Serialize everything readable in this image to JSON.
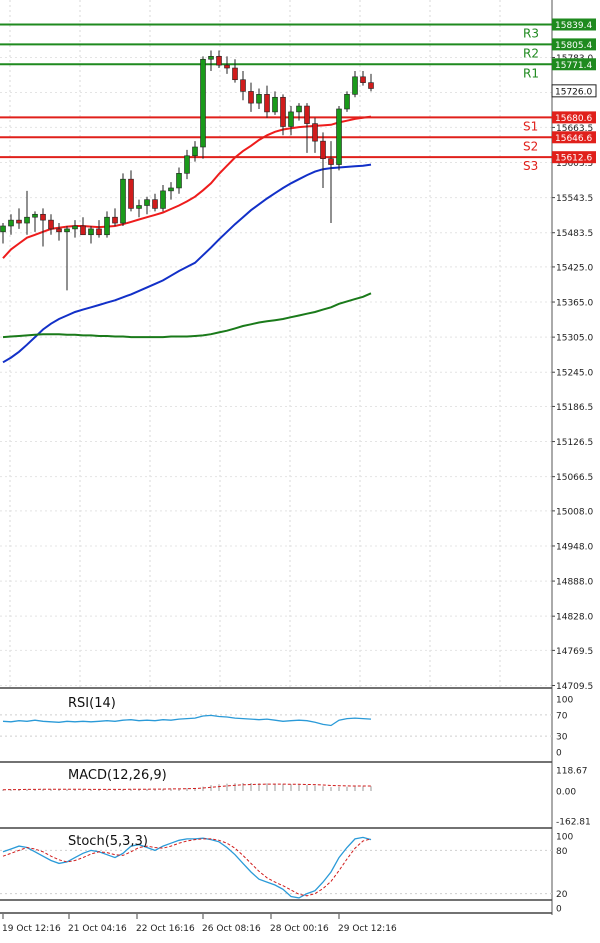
{
  "chart_data": {
    "type": "candlestick",
    "timeframe_labels": [
      "19 Oct 12:16",
      "21 Oct 04:16",
      "22 Oct 16:16",
      "26 Oct 08:16",
      "28 Oct 00:16",
      "29 Oct 12:16"
    ],
    "price_axis": {
      "ticks": [
        "15839.4",
        "15783.0",
        "15723.1",
        "15663.5",
        "15603.5",
        "15543.5",
        "15483.5",
        "15425.0",
        "15365.0",
        "15305.0",
        "15245.0",
        "15186.5",
        "15126.5",
        "15066.5",
        "15008.0",
        "14948.0",
        "14888.0",
        "14828.0",
        "14769.5",
        "14709.5"
      ],
      "current_price": "15726.0"
    },
    "levels": [
      {
        "name": "R3",
        "value": 15839.4,
        "label": "15839.4",
        "kind": "resistance",
        "color": "#1f8a1f"
      },
      {
        "name": "R2",
        "value": 15805.4,
        "label": "15805.4",
        "kind": "resistance",
        "color": "#1f8a1f"
      },
      {
        "name": "R1",
        "value": 15771.4,
        "label": "15771.4",
        "kind": "resistance",
        "color": "#1f8a1f"
      },
      {
        "name": "S1",
        "value": 15680.6,
        "label": "15680.6",
        "kind": "support",
        "color": "#e0201b"
      },
      {
        "name": "S2",
        "value": 15646.6,
        "label": "15646.6",
        "kind": "support",
        "color": "#e0201b"
      },
      {
        "name": "S3",
        "value": 15612.6,
        "label": "15612.6",
        "kind": "support",
        "color": "#e0201b"
      }
    ],
    "candles": [
      {
        "o": 15485,
        "h": 15500,
        "l": 15465,
        "c": 15495
      },
      {
        "o": 15495,
        "h": 15515,
        "l": 15480,
        "c": 15505
      },
      {
        "o": 15505,
        "h": 15525,
        "l": 15490,
        "c": 15500
      },
      {
        "o": 15500,
        "h": 15555,
        "l": 15480,
        "c": 15510
      },
      {
        "o": 15510,
        "h": 15520,
        "l": 15485,
        "c": 15515
      },
      {
        "o": 15515,
        "h": 15525,
        "l": 15460,
        "c": 15505
      },
      {
        "o": 15505,
        "h": 15515,
        "l": 15480,
        "c": 15490
      },
      {
        "o": 15490,
        "h": 15500,
        "l": 15470,
        "c": 15485
      },
      {
        "o": 15485,
        "h": 15495,
        "l": 15385,
        "c": 15490
      },
      {
        "o": 15490,
        "h": 15505,
        "l": 15475,
        "c": 15495
      },
      {
        "o": 15495,
        "h": 15510,
        "l": 15480,
        "c": 15480
      },
      {
        "o": 15480,
        "h": 15495,
        "l": 15465,
        "c": 15490
      },
      {
        "o": 15490,
        "h": 15505,
        "l": 15475,
        "c": 15480
      },
      {
        "o": 15480,
        "h": 15520,
        "l": 15475,
        "c": 15510
      },
      {
        "o": 15510,
        "h": 15525,
        "l": 15495,
        "c": 15500
      },
      {
        "o": 15500,
        "h": 15585,
        "l": 15495,
        "c": 15575
      },
      {
        "o": 15575,
        "h": 15590,
        "l": 15520,
        "c": 15525
      },
      {
        "o": 15525,
        "h": 15540,
        "l": 15510,
        "c": 15530
      },
      {
        "o": 15530,
        "h": 15545,
        "l": 15515,
        "c": 15540
      },
      {
        "o": 15540,
        "h": 15550,
        "l": 15520,
        "c": 15525
      },
      {
        "o": 15525,
        "h": 15565,
        "l": 15520,
        "c": 15555
      },
      {
        "o": 15555,
        "h": 15570,
        "l": 15540,
        "c": 15560
      },
      {
        "o": 15560,
        "h": 15595,
        "l": 15550,
        "c": 15585
      },
      {
        "o": 15585,
        "h": 15625,
        "l": 15575,
        "c": 15615
      },
      {
        "o": 15615,
        "h": 15640,
        "l": 15605,
        "c": 15630
      },
      {
        "o": 15630,
        "h": 15785,
        "l": 15610,
        "c": 15780
      },
      {
        "o": 15780,
        "h": 15795,
        "l": 15760,
        "c": 15785
      },
      {
        "o": 15785,
        "h": 15795,
        "l": 15765,
        "c": 15770
      },
      {
        "o": 15770,
        "h": 15785,
        "l": 15755,
        "c": 15765
      },
      {
        "o": 15765,
        "h": 15780,
        "l": 15740,
        "c": 15745
      },
      {
        "o": 15745,
        "h": 15760,
        "l": 15710,
        "c": 15725
      },
      {
        "o": 15725,
        "h": 15740,
        "l": 15690,
        "c": 15705
      },
      {
        "o": 15705,
        "h": 15730,
        "l": 15695,
        "c": 15720
      },
      {
        "o": 15720,
        "h": 15735,
        "l": 15680,
        "c": 15690
      },
      {
        "o": 15690,
        "h": 15725,
        "l": 15685,
        "c": 15715
      },
      {
        "o": 15715,
        "h": 15720,
        "l": 15650,
        "c": 15665
      },
      {
        "o": 15665,
        "h": 15700,
        "l": 15650,
        "c": 15690
      },
      {
        "o": 15690,
        "h": 15705,
        "l": 15675,
        "c": 15700
      },
      {
        "o": 15700,
        "h": 15705,
        "l": 15620,
        "c": 15670
      },
      {
        "o": 15670,
        "h": 15680,
        "l": 15620,
        "c": 15640
      },
      {
        "o": 15640,
        "h": 15655,
        "l": 15560,
        "c": 15610
      },
      {
        "o": 15610,
        "h": 15640,
        "l": 15500,
        "c": 15600
      },
      {
        "o": 15600,
        "h": 15700,
        "l": 15590,
        "c": 15695
      },
      {
        "o": 15695,
        "h": 15725,
        "l": 15690,
        "c": 15720
      },
      {
        "o": 15720,
        "h": 15760,
        "l": 15715,
        "c": 15750
      },
      {
        "o": 15750,
        "h": 15760,
        "l": 15735,
        "c": 15740
      },
      {
        "o": 15740,
        "h": 15755,
        "l": 15725,
        "c": 15730
      }
    ],
    "moving_averages": [
      {
        "name": "MA fast",
        "color": "#ee1c1c",
        "values": [
          15440,
          15455,
          15465,
          15475,
          15480,
          15485,
          15490,
          15492,
          15494,
          15495,
          15495,
          15494,
          15493,
          15494,
          15495,
          15498,
          15502,
          15506,
          15510,
          15514,
          15518,
          15524,
          15530,
          15537,
          15545,
          15556,
          15568,
          15584,
          15598,
          15612,
          15623,
          15632,
          15642,
          15650,
          15656,
          15660,
          15662,
          15664,
          15665,
          15666,
          15667,
          15668,
          15672,
          15675,
          15678,
          15680,
          15682
        ]
      },
      {
        "name": "MA mid",
        "color": "#1230c8",
        "values": [
          15262,
          15270,
          15280,
          15292,
          15305,
          15318,
          15328,
          15336,
          15342,
          15348,
          15352,
          15356,
          15360,
          15364,
          15368,
          15373,
          15378,
          15384,
          15390,
          15396,
          15402,
          15410,
          15418,
          15425,
          15432,
          15445,
          15458,
          15472,
          15485,
          15498,
          15510,
          15522,
          15532,
          15542,
          15551,
          15560,
          15568,
          15575,
          15582,
          15588,
          15592,
          15594,
          15595,
          15596,
          15597,
          15598,
          15600
        ]
      },
      {
        "name": "MA slow",
        "color": "#1a7a1a",
        "values": [
          15305,
          15306,
          15307,
          15308,
          15309,
          15310,
          15310,
          15310,
          15309,
          15309,
          15308,
          15308,
          15307,
          15307,
          15306,
          15306,
          15305,
          15305,
          15305,
          15305,
          15305,
          15306,
          15306,
          15306,
          15307,
          15308,
          15310,
          15313,
          15316,
          15320,
          15324,
          15327,
          15330,
          15332,
          15334,
          15336,
          15339,
          15342,
          15345,
          15348,
          15352,
          15356,
          15362,
          15366,
          15370,
          15374,
          15380
        ]
      }
    ],
    "rsi": {
      "label": "RSI(14)",
      "ticks": [
        "100",
        "70",
        "30",
        "0"
      ],
      "values": [
        58,
        57,
        59,
        58,
        60,
        58,
        57,
        56,
        58,
        57,
        58,
        57,
        58,
        59,
        58,
        60,
        61,
        59,
        60,
        59,
        61,
        60,
        62,
        63,
        64,
        68,
        69,
        67,
        66,
        64,
        63,
        62,
        61,
        62,
        60,
        58,
        59,
        60,
        59,
        56,
        52,
        50,
        60,
        63,
        64,
        63,
        62
      ]
    },
    "macd": {
      "label": "MACD(12,26,9)",
      "ticks": [
        "118.67",
        "0.00",
        "-162.81"
      ],
      "values": [
        8,
        9,
        10,
        10,
        11,
        11,
        11,
        10,
        10,
        9,
        9,
        9,
        9,
        9,
        9,
        10,
        11,
        11,
        11,
        12,
        12,
        13,
        14,
        16,
        18,
        25,
        33,
        38,
        42,
        44,
        45,
        45,
        44,
        43,
        42,
        40,
        38,
        36,
        34,
        31,
        27,
        22,
        23,
        24,
        26,
        26,
        27
      ],
      "signal": [
        7,
        8,
        8,
        9,
        9,
        10,
        10,
        10,
        10,
        10,
        10,
        9,
        9,
        9,
        9,
        9,
        10,
        10,
        10,
        11,
        11,
        12,
        12,
        13,
        14,
        17,
        21,
        25,
        29,
        32,
        35,
        37,
        38,
        39,
        39,
        39,
        38,
        38,
        37,
        36,
        34,
        31,
        30,
        29,
        28,
        28,
        28
      ]
    },
    "stoch": {
      "label": "Stoch(5,3,3)",
      "ticks": [
        "100",
        "80",
        "20",
        "0"
      ],
      "k": [
        78,
        82,
        86,
        84,
        78,
        72,
        66,
        62,
        64,
        70,
        76,
        80,
        78,
        74,
        70,
        76,
        86,
        88,
        84,
        80,
        86,
        90,
        94,
        96,
        96,
        97,
        95,
        92,
        84,
        74,
        62,
        50,
        40,
        36,
        32,
        26,
        16,
        14,
        20,
        24,
        36,
        50,
        70,
        84,
        96,
        98,
        95
      ],
      "d": [
        72,
        76,
        80,
        84,
        82,
        78,
        72,
        67,
        64,
        66,
        70,
        75,
        78,
        77,
        74,
        73,
        78,
        84,
        86,
        84,
        83,
        86,
        90,
        93,
        95,
        96,
        96,
        94,
        90,
        83,
        73,
        62,
        51,
        42,
        36,
        31,
        25,
        19,
        17,
        20,
        27,
        37,
        52,
        68,
        83,
        93,
        96
      ]
    }
  }
}
